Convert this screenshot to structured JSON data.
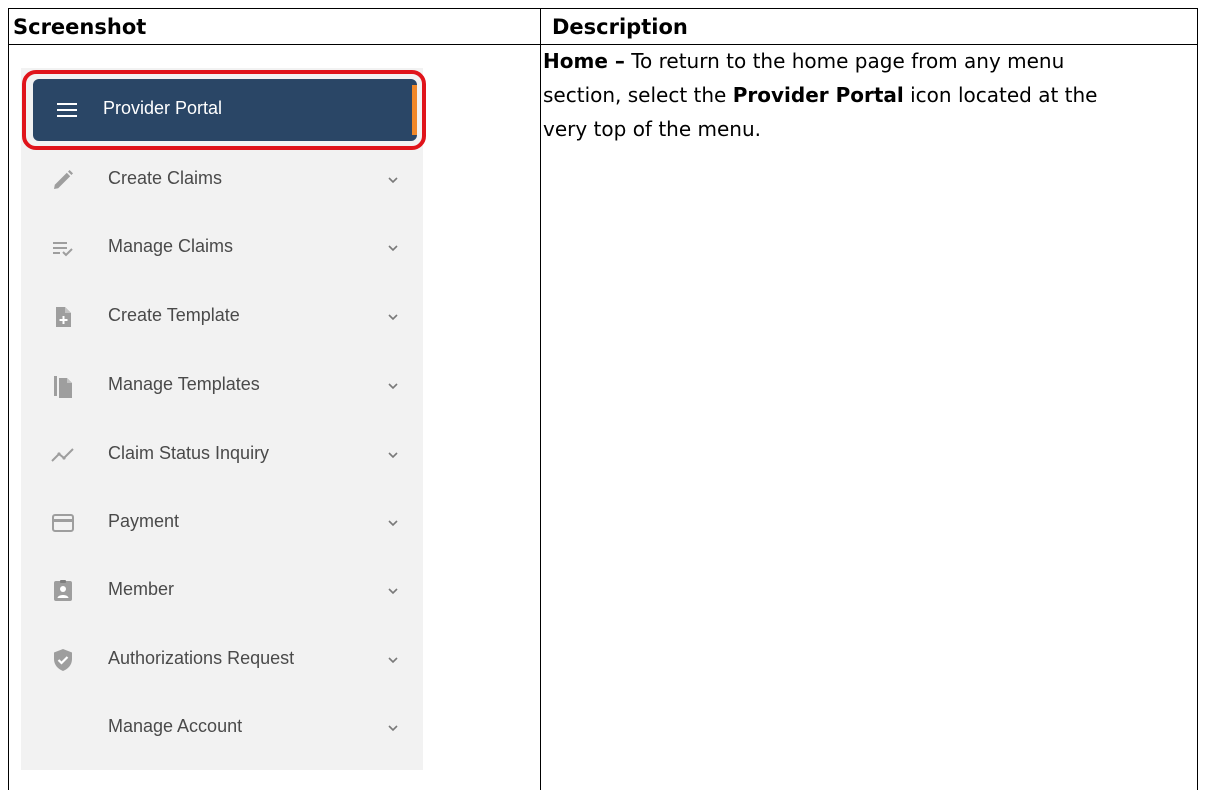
{
  "table": {
    "header_left": "Screenshot",
    "header_right": "Description"
  },
  "description": {
    "lead_bold": "Home –",
    "text_1": " To return to the home page from any menu section, select the ",
    "link_bold": "Provider Portal",
    "text_2": " icon located at the very top of the menu."
  },
  "menu": {
    "portal": {
      "label": "Provider Portal",
      "icon": "hamburger-menu-icon"
    },
    "items": [
      {
        "label": "Create Claims",
        "icon": "pencil-icon"
      },
      {
        "label": "Manage Claims",
        "icon": "list-check-icon"
      },
      {
        "label": "Create Template",
        "icon": "file-plus-icon"
      },
      {
        "label": "Manage Templates",
        "icon": "copy-files-icon"
      },
      {
        "label": "Claim Status Inquiry",
        "icon": "trend-line-icon"
      },
      {
        "label": "Payment",
        "icon": "credit-card-icon"
      },
      {
        "label": "Member",
        "icon": "member-badge-icon"
      },
      {
        "label": "Authorizations Request",
        "icon": "shield-check-icon"
      },
      {
        "label": "Manage Account",
        "icon": ""
      }
    ]
  },
  "colors": {
    "portal_bar": "#2a4666",
    "accent": "#f0882a",
    "highlight_ring": "#e0141b",
    "menu_background": "#f2f2f2",
    "icon_gray": "#9e9e9e",
    "label_gray": "#4a4a4a"
  }
}
